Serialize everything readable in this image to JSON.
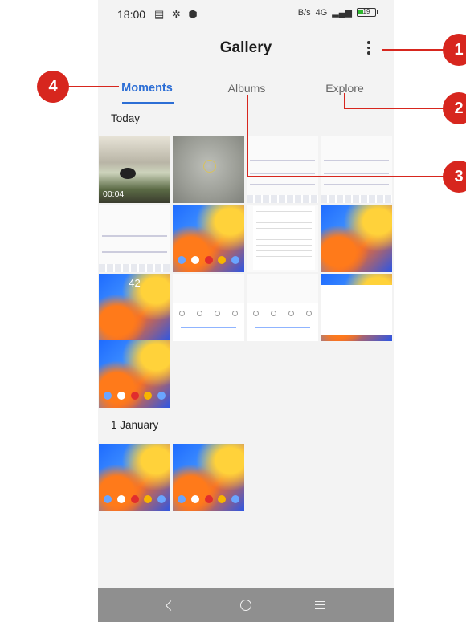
{
  "status_bar": {
    "time": "18:00",
    "left_icons": "▤ ✲ ⬢",
    "speed": "B/s",
    "network": "4G",
    "battery": "19"
  },
  "app_bar": {
    "title": "Gallery"
  },
  "tabs": [
    {
      "label": "Moments",
      "active": true
    },
    {
      "label": "Albums",
      "active": false
    },
    {
      "label": "Explore",
      "active": false
    }
  ],
  "sections": [
    {
      "label": "Today"
    },
    {
      "label": "1 January"
    }
  ],
  "media": {
    "video_duration": "00:04",
    "lock_time": "42"
  },
  "callouts": [
    "1",
    "2",
    "3",
    "4"
  ],
  "colors": {
    "accent": "#2c6ed5",
    "callout": "#d7261e",
    "navbar": "#8f8f8f"
  }
}
